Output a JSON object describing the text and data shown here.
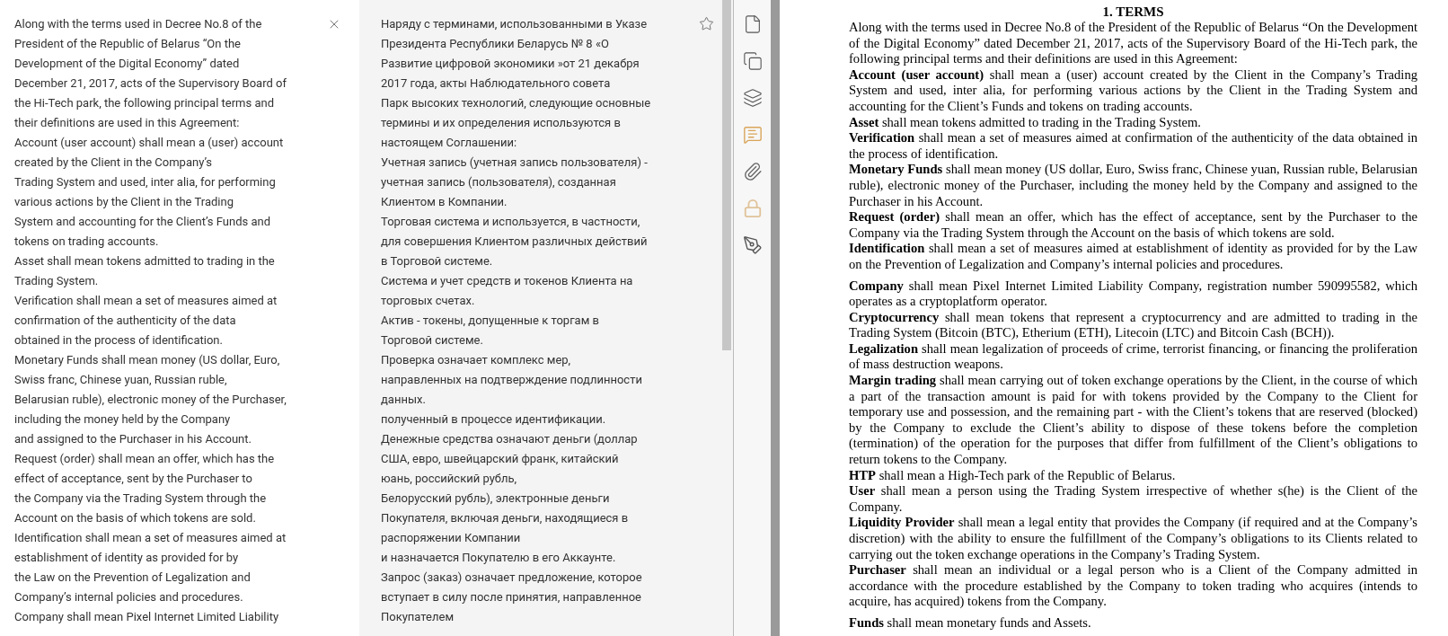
{
  "source_panel": {
    "lines": [
      "Along with the terms used in Decree No.8 of the",
      "President of the Republic of Belarus “On the",
      "Development of the Digital Economy” dated",
      "December 21, 2017, acts of the Supervisory Board of",
      "the Hi-Tech park, the following principal terms and",
      "their definitions are used in this Agreement:",
      "Account (user account) shall mean a (user) account",
      "created by the Client in the Company’s",
      "Trading System and used, inter alia, for performing",
      "various actions by the Client in the Trading",
      "System and accounting for the Client’s Funds and",
      "tokens on trading accounts.",
      "Asset shall mean tokens admitted to trading in the",
      "Trading System.",
      "Verification shall mean a set of measures aimed at",
      "confirmation of the authenticity of the data",
      "obtained in the process of identification.",
      "Monetary Funds shall mean money (US dollar, Euro,",
      "Swiss franc, Chinese yuan, Russian ruble,",
      "Belarusian ruble), electronic money of the Purchaser,",
      "including the money held by the Company",
      "and assigned to the Purchaser in his Account.",
      "Request (order) shall mean an offer, which has the",
      "effect of acceptance, sent by the Purchaser to",
      "the Company via the Trading System through the",
      "Account on the basis of which tokens are sold.",
      "Identification shall mean a set of measures aimed at",
      "establishment of identity as provided for by",
      "the Law on the Prevention of Legalization and",
      "Company’s internal policies and procedures.",
      "Company shall mean Pixel Internet Limited Liability"
    ]
  },
  "translation_panel": {
    "starred": false,
    "lines": [
      "Наряду с терминами, использованными в Указе",
      "Президента Республики Беларусь № 8 «О",
      "Развитие цифровой экономики »от 21 декабря",
      "2017 года, акты Наблюдательного совета",
      "Парк высоких технологий, следующие основные",
      "термины и их определения используются в",
      "настоящем Соглашении:",
      "Учетная запись (учетная запись пользователя) -",
      "учетная запись (пользователя), созданная",
      "Клиентом в Компании.",
      "Торговая система и используется, в частности,",
      "для совершения Клиентом различных действий",
      "в Торговой системе.",
      "Система и учет средств и токенов Клиента на",
      "торговых счетах.",
      "Актив - токены, допущенные к торгам в",
      "Торговой системе.",
      "Проверка означает комплекс мер,",
      "направленных на подтверждение подлинности",
      "данных.",
      "полученный в процессе идентификации.",
      "Денежные средства означают деньги (доллар",
      "США, евро, швейцарский франк, китайский",
      "юань, российский рубль,",
      "Белорусский рубль), электронные деньги",
      "Покупателя, включая деньги, находящиеся в",
      "распоряжении Компании",
      "и назначается Покупателю в его Аккаунте.",
      "Запрос (заказ) означает предложение, которое",
      "вступает в силу после принятия, направленное",
      "Покупателем"
    ]
  },
  "document": {
    "heading": "1. TERMS",
    "blocks": [
      {
        "paragraphs": [
          "Along with the terms used in Decree No.8 of the President of the Republic of Belarus “On the Development of the Digital Economy” dated December 21, 2017, acts of the Supervisory Board of the Hi-Tech park, the following principal terms and their definitions are used in this Agreement:",
          "**Account (user account)** shall mean a (user) account created by the Client in the Company’s Trading System and used, inter alia, for performing various actions by the Client in the Trading System and accounting for the Client’s Funds and tokens on trading accounts.",
          "**Asset** shall mean tokens admitted to trading in the Trading System.",
          "**Verification** shall mean a set of measures aimed at confirmation of the authenticity of the data obtained in the process of identification.",
          "**Monetary Funds** shall mean money (US dollar, Euro, Swiss franc, Chinese yuan, Russian ruble, Belarusian ruble), electronic money of the Purchaser, including the money held by the Company and assigned to the Purchaser in his Account.",
          "**Request (order)** shall mean an offer, which has the effect of acceptance, sent by the Purchaser to the Company via the Trading System through the Account on the basis of which tokens are sold.",
          "**Identification** shall mean a set of measures aimed at establishment of identity as provided for by the Law on the Prevention of Legalization and Company’s internal policies and procedures."
        ]
      },
      {
        "paragraphs": [
          "**Company** shall mean Pixel Internet Limited Liability Company, registration number 590995582, which operates as a cryptoplatform operator.",
          "**Cryptocurrency** shall mean tokens that represent a cryptocurrency and are admitted to trading in the Trading System (Bitcoin (BTC), Etherium (ETH), Litecoin (LTC) and Bitcoin Cash (BCH)).",
          "**Legalization** shall mean legalization of proceeds of crime, terrorist financing, or financing the proliferation of mass destruction weapons.",
          "**Margin trading** shall mean carrying out of token exchange operations by the Client, in the course of which a part of the transaction amount is paid for with tokens provided by the Company to the Client for temporary use and possession, and the remaining part - with the Client’s tokens that are reserved (blocked) by the Company to exclude the Client’s ability to dispose of these tokens before the completion (termination) of the operation for the purposes that differ from fulfillment of the Client’s obligations to return tokens to the Company.",
          "**HTP** shall mean a High-Tech park of the Republic of Belarus.",
          "**User** shall mean a person using the Trading System irrespective of whether s(he) is the Client of the Company.",
          "**Liquidity Provider** shall mean a legal entity that provides the Company (if required and at the Company’s discretion) with the ability to ensure the fulfillment of the Company’s obligations to its Clients related to carrying out the token exchange operations in the Company’s Trading System.",
          "**Purchaser** shall mean an individual or a legal person who is a Client of the Company admitted in accordance with the procedure established by the Company to token trading who acquires (intends to acquire, has acquired) tokens from the Company."
        ]
      },
      {
        "paragraphs": [
          "**Funds** shall mean monetary funds and Assets."
        ]
      }
    ]
  }
}
